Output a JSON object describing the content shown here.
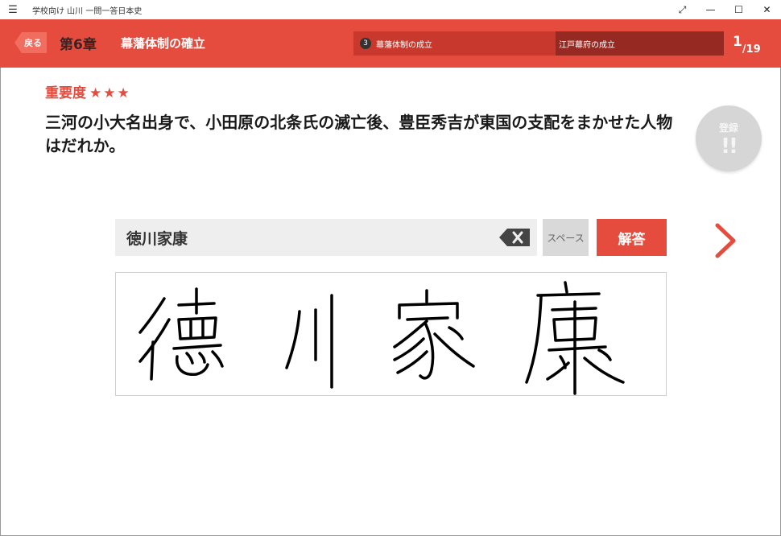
{
  "window": {
    "title": "学校向け 山川 一問一答日本史",
    "menu_glyph": "☰",
    "controls": {
      "fullscreen": "⤢",
      "minimize": "—",
      "maximize": "☐",
      "close": "✕"
    }
  },
  "header": {
    "back_label": "戻る",
    "chapter": "第6章",
    "chapter_title": "幕藩体制の確立",
    "section_number": "3",
    "section_title": "幕藩体制の成立",
    "subsection_title": "江戸幕府の成立",
    "page_current": "1",
    "page_total": "/19"
  },
  "question": {
    "importance_label": "重要度",
    "stars": "★★★",
    "importance_level": 3,
    "text": "三河の小大名出身で、小田原の北条氏の滅亡後、豊臣秀吉が東国の支配をまかせた人物はだれか。"
  },
  "bookmark": {
    "label": "登録",
    "icon": "!!"
  },
  "answer": {
    "value": "徳川家康",
    "space_label": "スペース",
    "submit_label": "解答"
  },
  "colors": {
    "accent": "#e64c3e",
    "crumb_active": "#c8382c",
    "crumb_current": "#962a22",
    "input_bg": "#eeeeee"
  }
}
